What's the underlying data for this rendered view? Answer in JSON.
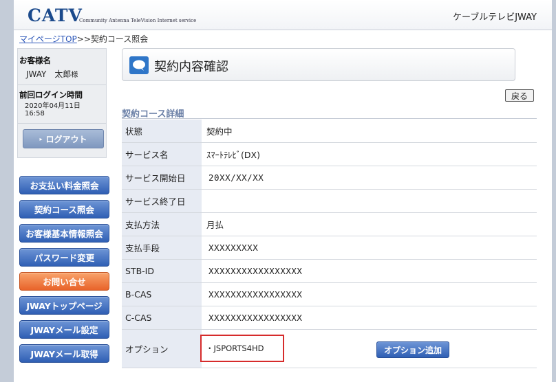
{
  "header": {
    "logo": "CATV",
    "logo_sub": "Community Antenna TeleVision Internet service",
    "brand": "ケーブルテレビJWAY"
  },
  "breadcrumb": {
    "link": "マイページTOP",
    "separator": ">>",
    "current": "契約コース照会"
  },
  "user": {
    "name_label": "お客様名",
    "name": "JWAY　太郎",
    "honorific": "様",
    "last_login_label": "前回ログイン時間",
    "last_login_date": "2020年04月11日",
    "last_login_time": "16:58",
    "logout_label": "ログアウト"
  },
  "nav": [
    {
      "label": "お支払い料金照会"
    },
    {
      "label": "契約コース照会"
    },
    {
      "label": "お客様基本情報照会"
    },
    {
      "label": "パスワード変更"
    },
    {
      "label": "お問い合せ"
    },
    {
      "label": "JWAYトップページ"
    },
    {
      "label": "JWAYメール設定"
    },
    {
      "label": "JWAYメール取得"
    }
  ],
  "main": {
    "title": "契約内容確認",
    "back_label": "戻る",
    "section_title": "契約コース詳細",
    "rows": [
      {
        "label": "状態",
        "value": "契約中"
      },
      {
        "label": "サービス名",
        "value": "ｽﾏｰﾄﾃﾚﾋﾞ(DX)"
      },
      {
        "label": "サービス開始日",
        "value": "20XX/XX/XX"
      },
      {
        "label": "サービス終了日",
        "value": ""
      },
      {
        "label": "支払方法",
        "value": "月払"
      },
      {
        "label": "支払手段",
        "value": "XXXXXXXXX"
      },
      {
        "label": "STB-ID",
        "value": "XXXXXXXXXXXXXXXXX"
      },
      {
        "label": "B-CAS",
        "value": "XXXXXXXXXXXXXXXXX"
      },
      {
        "label": "C-CAS",
        "value": "XXXXXXXXXXXXXXXXX"
      }
    ],
    "option": {
      "label": "オプション",
      "value": "・JSPORTS4HD",
      "add_label": "オプション追加"
    }
  },
  "colors": {
    "nav_blue": "#2f5fb4",
    "nav_orange": "#e8632a",
    "highlight_red": "#d62b2b"
  }
}
